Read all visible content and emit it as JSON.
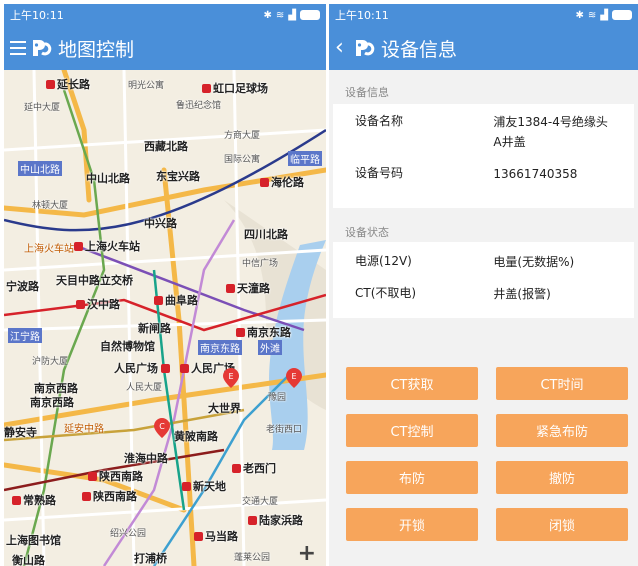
{
  "status": {
    "time": "上午10:11"
  },
  "left_screen": {
    "title": "地图控制",
    "map_labels": {
      "yanchang_road": "延长路",
      "mingguang": "明光公寓",
      "hongkou": "虹口足球场",
      "yanzhong": "延中大厦",
      "luxun": "鲁迅纪念馆",
      "fangshang": "方商大厦",
      "xizang_n": "西藏北路",
      "guoji_cn": "国际公寓",
      "linping": "临平路",
      "zhongshan_n1": "中山北路",
      "zhongshan_n2": "中山北路",
      "dongbao": "东宝兴路",
      "hailun": "海伦路",
      "linhang": "林顿大厦",
      "zhongxing": "中兴路",
      "sichuan_n": "四川北路",
      "shanghai_stn1": "上海火车站",
      "shanghai_stn2": "上海火车站",
      "tianmu": "天目中路立交桥",
      "zhongxin": "中信广场",
      "ningbo": "宁波路",
      "hanzhong": "汉中路",
      "qufu": "曲阜路",
      "tiantong": "天潼路",
      "xinzha": "新闸路",
      "nanjing_e": "南京东路",
      "jiangning": "江宁路",
      "zirans": "自然博物馆",
      "nanjing_e2": "南京东路",
      "waitan": "外滩",
      "hufang": "沪防大厦",
      "renmin1": "人民广场",
      "renmin2": "人民广场",
      "nanjing_w1": "南京西路",
      "renmin_build": "人民大厦",
      "nanjing_w2": "南京西路",
      "yuyuan": "豫园",
      "dashijie": "大世界",
      "jingan": "静安寺",
      "yanan": "延安中路",
      "huangpi": "黄陂南路",
      "laojie": "老街西口",
      "huaihai": "淮海中路",
      "laoximen": "老西门",
      "shaanxi1": "陕西南路",
      "shaanxi2": "陕西南路",
      "xintiandi": "新天地",
      "changshu": "常熟路",
      "jiaotong": "交通大厦",
      "lujiabang": "陆家浜路",
      "library": "上海图书馆",
      "shaoxing": "绍兴公园",
      "madang": "马当路",
      "hengshan": "衡山路",
      "dapu": "打浦桥",
      "penglai": "蓬莱公园"
    }
  },
  "right_screen": {
    "title": "设备信息",
    "info_section": "设备信息",
    "device_name_label": "设备名称",
    "device_name_value": "浦友1384-4号绝缘头A井盖",
    "device_no_label": "设备号码",
    "device_no_value": "13661740358",
    "status_section": "设备状态",
    "power_label": "电源(12V)",
    "battery_label": "电量(无数据%)",
    "ct_label": "CT(不取电)",
    "cover_label": "井盖(报警)",
    "buttons": [
      "CT获取",
      "CT时间",
      "CT控制",
      "紧急布防",
      "布防",
      "撤防",
      "开锁",
      "闭锁"
    ]
  },
  "colors": {
    "brand": "#4a8fd9",
    "button": "#f7a55b",
    "metro": "#d6222a",
    "pin": "#e53935"
  }
}
